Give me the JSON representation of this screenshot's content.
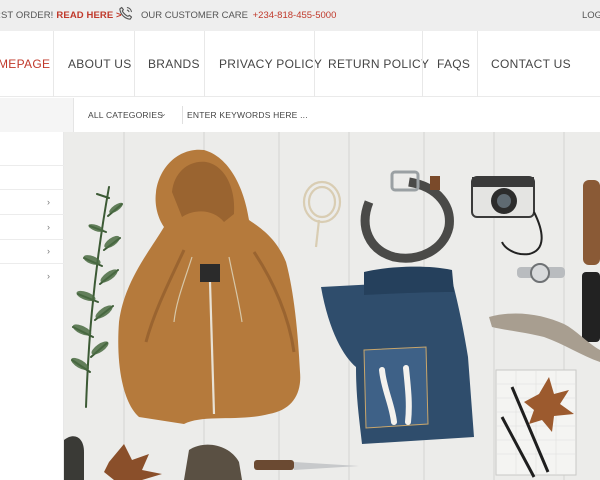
{
  "topbar": {
    "promo_text": "RST ORDER!",
    "promo_link": "READ HERE >",
    "care_label": "OUR CUSTOMER CARE",
    "care_number": "+234-818-455-5000",
    "login_label": "LOG"
  },
  "nav": {
    "items": [
      {
        "label": "MEPAGE",
        "active": true
      },
      {
        "label": "ABOUT US"
      },
      {
        "label": "BRANDS"
      },
      {
        "label": "PRIVACY POLICY"
      },
      {
        "label": "RETURN POLICY"
      },
      {
        "label": "FAQS"
      },
      {
        "label": "CONTACT US"
      }
    ]
  },
  "search": {
    "category_label": "ALL CATEGORIES",
    "placeholder": "ENTER KEYWORDS HERE ..."
  },
  "colors": {
    "accent": "#c0392b",
    "topbar_bg": "#eeeeee"
  },
  "icons": [
    "phone-icon",
    "chevron-down-icon",
    "chevron-right-icon"
  ]
}
